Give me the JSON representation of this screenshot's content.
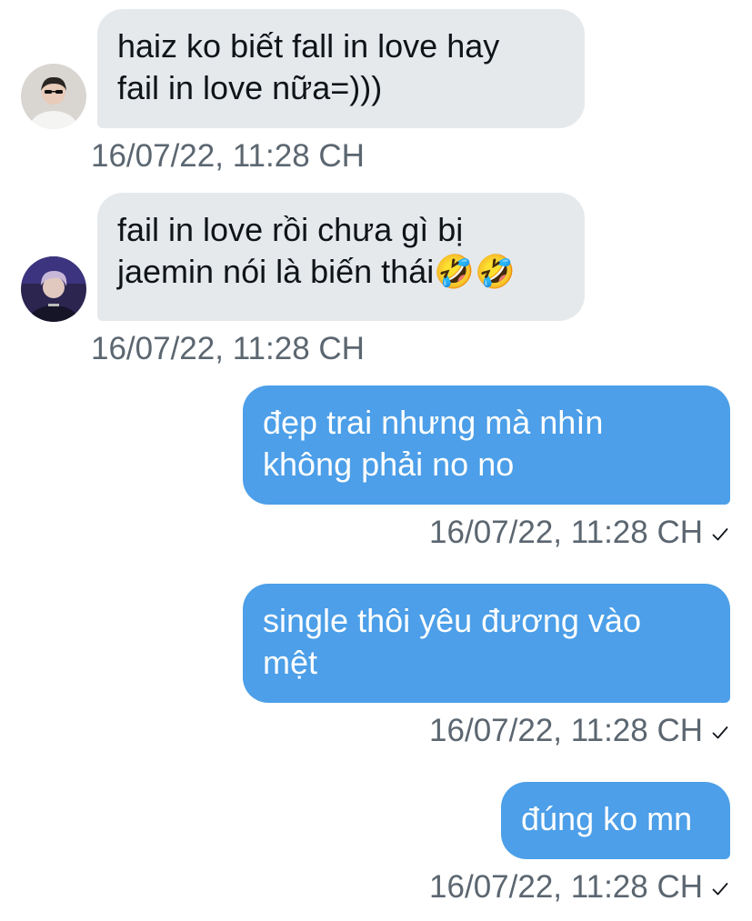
{
  "messages": [
    {
      "direction": "in",
      "text": "haiz ko biết fall in love hay\nfail in love nữa=)))",
      "time": "16/07/22, 11:28 CH",
      "avatar": "user-avatar-1"
    },
    {
      "direction": "in",
      "text": "fail in love rồi chưa gì bị\njaemin nói là biến thái🤣🤣",
      "time": "16/07/22, 11:28 CH",
      "avatar": "user-avatar-2"
    },
    {
      "direction": "out",
      "text": "đẹp trai nhưng mà nhìn\nkhông phải no no",
      "time": "16/07/22, 11:28 CH",
      "status_icon": "checkmark-icon"
    },
    {
      "direction": "out",
      "text": "single thôi yêu đương vào\nmệt",
      "time": "16/07/22, 11:28 CH",
      "status_icon": "checkmark-icon"
    },
    {
      "direction": "out",
      "text": "đúng ko mn",
      "time": "16/07/22, 11:28 CH",
      "status_icon": "checkmark-icon"
    }
  ],
  "colors": {
    "incoming_bubble": "#e6e9ec",
    "outgoing_bubble": "#4c9fe8",
    "timestamp": "#5b6670"
  }
}
